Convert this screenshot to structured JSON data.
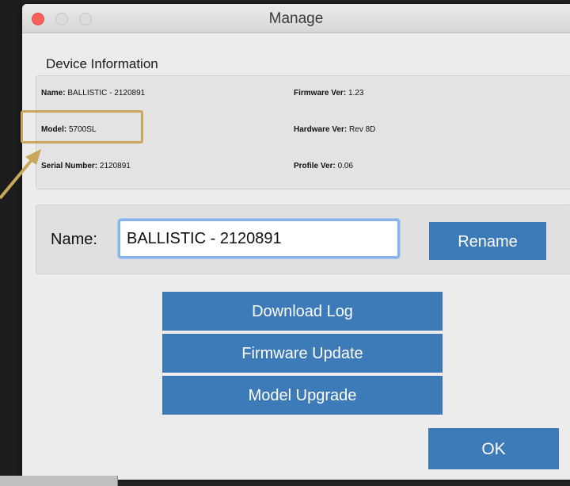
{
  "window": {
    "title": "Manage"
  },
  "device_info": {
    "section_label": "Device Information",
    "name": {
      "label": "Name:",
      "value": "BALLISTIC - 2120891"
    },
    "model": {
      "label": "Model:",
      "value": "5700SL"
    },
    "serial": {
      "label": "Serial Number:",
      "value": "2120891"
    },
    "firmware": {
      "label": "Firmware Ver:",
      "value": "1.23"
    },
    "hardware": {
      "label": "Hardware Ver:",
      "value": "Rev 8D"
    },
    "profile": {
      "label": "Profile Ver:",
      "value": "0.06"
    }
  },
  "rename": {
    "label": "Name:",
    "input_value": "BALLISTIC - 2120891",
    "button_label": "Rename"
  },
  "actions": {
    "download_log": "Download Log",
    "firmware_update": "Firmware Update",
    "model_upgrade": "Model Upgrade"
  },
  "footer": {
    "ok_label": "OK"
  },
  "colors": {
    "button": "#3d7ab8",
    "highlight": "#c9a85b",
    "close_light": "#fc605b"
  }
}
